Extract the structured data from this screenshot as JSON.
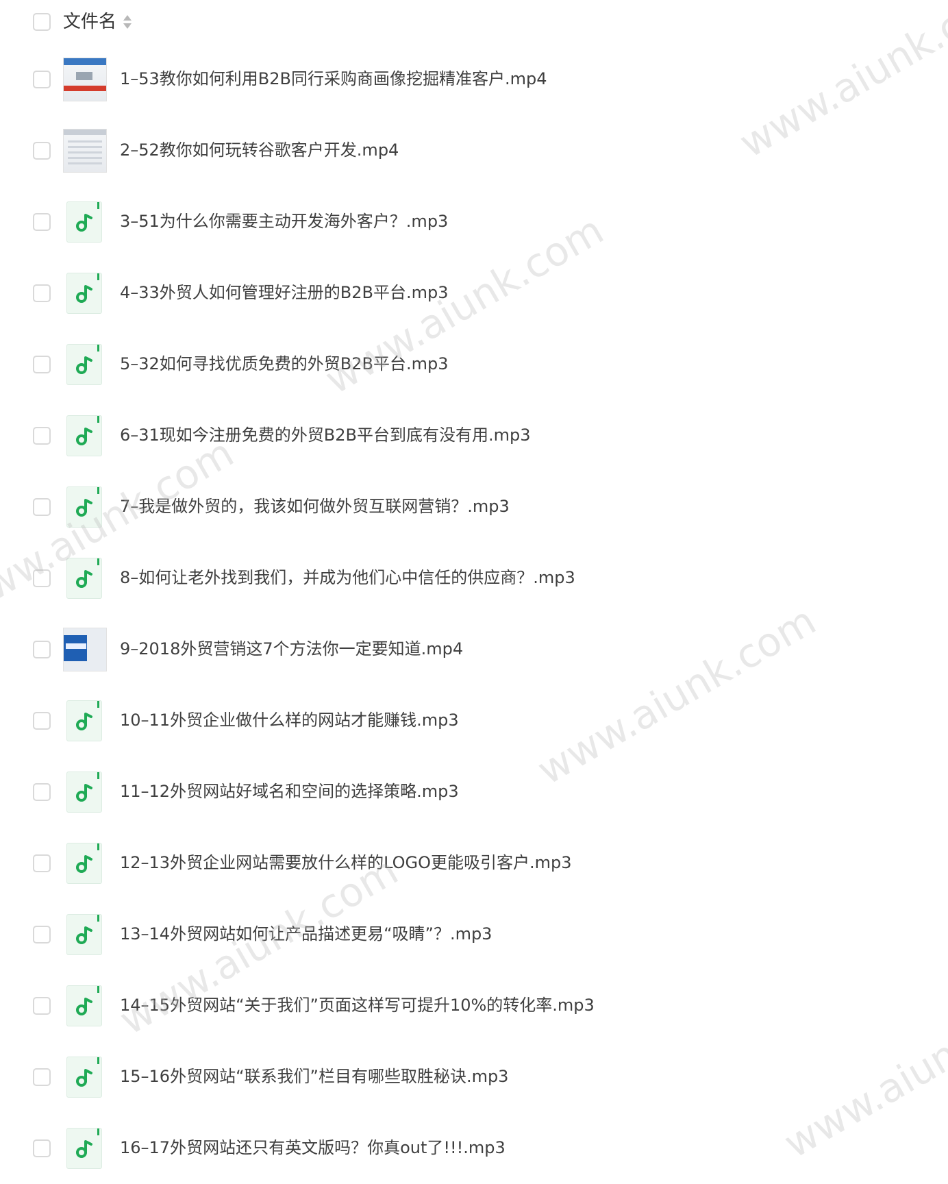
{
  "header": {
    "column_label": "文件名",
    "sort_icon": "sort-icon"
  },
  "files": [
    {
      "name": "1–53教你如何利用B2B同行采购商画像挖掘精准客户.mp4",
      "type": "video"
    },
    {
      "name": "2–52教你如何玩转谷歌客户开发.mp4",
      "type": "video"
    },
    {
      "name": "3–51为什么你需要主动开发海外客户？.mp3",
      "type": "audio"
    },
    {
      "name": "4–33外贸人如何管理好注册的B2B平台.mp3",
      "type": "audio"
    },
    {
      "name": "5–32如何寻找优质免费的外贸B2B平台.mp3",
      "type": "audio"
    },
    {
      "name": "6–31现如今注册免费的外贸B2B平台到底有没有用.mp3",
      "type": "audio"
    },
    {
      "name": "7–我是做外贸的，我该如何做外贸互联网营销？.mp3",
      "type": "audio"
    },
    {
      "name": "8–如何让老外找到我们，并成为他们心中信任的供应商？.mp3",
      "type": "audio"
    },
    {
      "name": "9–2018外贸营销这7个方法你一定要知道.mp4",
      "type": "video"
    },
    {
      "name": "10–11外贸企业做什么样的网站才能赚钱.mp3",
      "type": "audio"
    },
    {
      "name": "11–12外贸网站好域名和空间的选择策略.mp3",
      "type": "audio"
    },
    {
      "name": "12–13外贸企业网站需要放什么样的LOGO更能吸引客户.mp3",
      "type": "audio"
    },
    {
      "name": "13–14外贸网站如何让产品描述更易“吸睛”？.mp3",
      "type": "audio"
    },
    {
      "name": "14–15外贸网站“关于我们”页面这样写可提升10%的转化率.mp3",
      "type": "audio"
    },
    {
      "name": "15–16外贸网站“联系我们”栏目有哪些取胜秘诀.mp3",
      "type": "audio"
    },
    {
      "name": "16–17外贸网站还只有英文版吗？你真out了!!!.mp3",
      "type": "audio"
    }
  ],
  "watermark": {
    "text": "www.aiunk.com"
  },
  "colors": {
    "audio_icon": "#1faa55",
    "checkbox_border": "#d9d9d9",
    "text": "#3f3f3f"
  }
}
